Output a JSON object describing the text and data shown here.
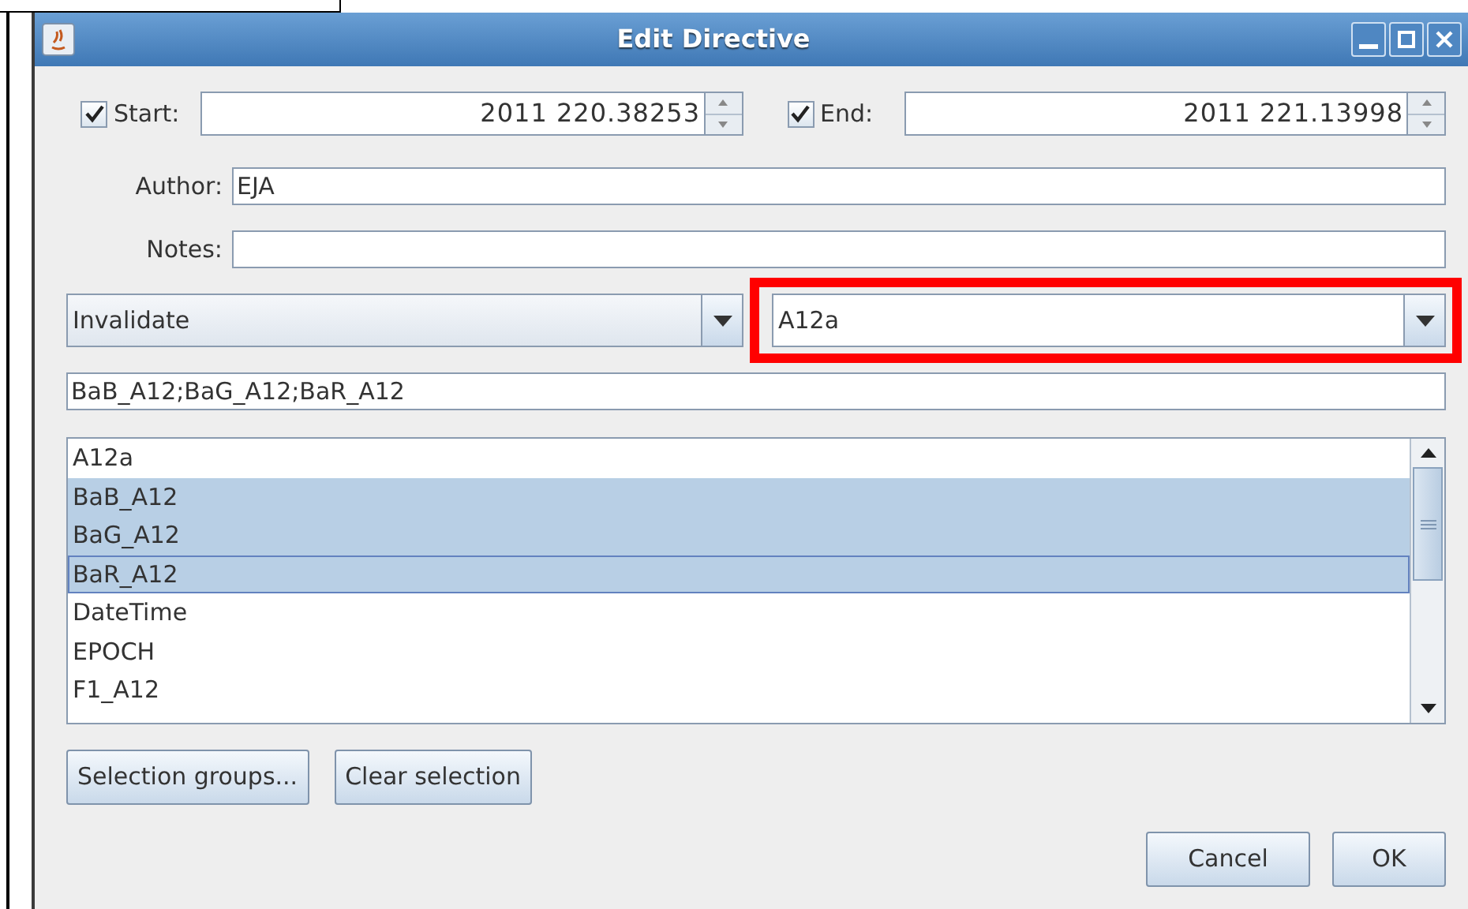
{
  "window": {
    "title": "Edit Directive"
  },
  "start": {
    "label": "Start:",
    "checked": true,
    "value": "2011 220.38253"
  },
  "end": {
    "label": "End:",
    "checked": true,
    "value": "2011 221.13998"
  },
  "author": {
    "label": "Author:",
    "value": "EJA"
  },
  "notes": {
    "label": "Notes:"
  },
  "action_combo": {
    "value": "Invalidate"
  },
  "variable_combo": {
    "value": "A12a",
    "highlighted": true
  },
  "selection_field": {
    "value": "BaB_A12;BaG_A12;BaR_A12"
  },
  "list": {
    "items": [
      {
        "label": "A12a",
        "selected": false,
        "focused": false
      },
      {
        "label": "BaB_A12",
        "selected": true,
        "focused": false
      },
      {
        "label": "BaG_A12",
        "selected": true,
        "focused": false
      },
      {
        "label": "BaR_A12",
        "selected": true,
        "focused": true
      },
      {
        "label": "DateTime",
        "selected": false,
        "focused": false
      },
      {
        "label": "EPOCH",
        "selected": false,
        "focused": false
      },
      {
        "label": "F1_A12",
        "selected": false,
        "focused": false
      }
    ]
  },
  "buttons": [
    "Selection groups...",
    "Clear selection"
  ],
  "dialog_buttons": [
    "Cancel",
    "OK"
  ]
}
